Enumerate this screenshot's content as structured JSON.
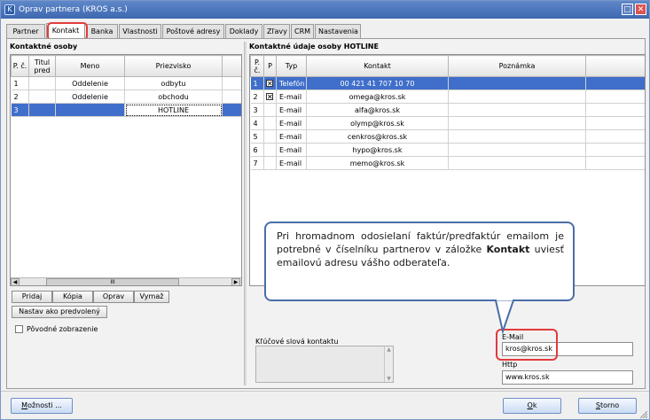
{
  "window": {
    "title": "Oprav partnera (KROS a.s.)",
    "icon": "app-icon",
    "buttons": {
      "restore": "□",
      "close": "✕"
    }
  },
  "tabs": [
    {
      "label": "Partner",
      "active": false
    },
    {
      "label": "Kontakt",
      "active": true
    },
    {
      "label": "Banka",
      "active": false
    },
    {
      "label": "Vlastnosti",
      "active": false
    },
    {
      "label": "Poštové adresy",
      "active": false
    },
    {
      "label": "Doklady",
      "active": false
    },
    {
      "label": "Zľavy",
      "active": false
    },
    {
      "label": "CRM",
      "active": false
    },
    {
      "label": "Nastavenia",
      "active": false
    }
  ],
  "left": {
    "title": "Kontaktné osoby",
    "columns": [
      "P. č.",
      "Titul pred",
      "Meno",
      "Priezvisko"
    ],
    "rows": [
      {
        "n": "1",
        "titul": "",
        "meno": "Oddelenie",
        "priezvisko": "odbytu",
        "selected": false
      },
      {
        "n": "2",
        "titul": "",
        "meno": "Oddelenie",
        "priezvisko": "obchodu",
        "selected": false
      },
      {
        "n": "3",
        "titul": "",
        "meno": "",
        "priezvisko": "HOTLINE",
        "selected": true
      }
    ],
    "scroll_thumb": "III",
    "buttons": {
      "add": "Pridaj",
      "copy": "Kópia",
      "edit": "Oprav",
      "delete": "Vymaž",
      "default": "Nastav ako predvolený"
    },
    "original_view_label": "Pôvodné zobrazenie"
  },
  "right": {
    "title": "Kontaktné údaje osoby HOTLINE",
    "columns": [
      "P. č.",
      "P",
      "Typ",
      "Kontakt",
      "Poznámka"
    ],
    "rows": [
      {
        "n": "1",
        "p": true,
        "typ": "Telefón",
        "kontakt": "00 421 41 707 10 70",
        "selected": true
      },
      {
        "n": "2",
        "p": true,
        "typ": "E-mail",
        "kontakt": "omega@kros.sk",
        "selected": false
      },
      {
        "n": "3",
        "p": false,
        "typ": "E-mail",
        "kontakt": "alfa@kros.sk",
        "selected": false
      },
      {
        "n": "4",
        "p": false,
        "typ": "E-mail",
        "kontakt": "olymp@kros.sk",
        "selected": false
      },
      {
        "n": "5",
        "p": false,
        "typ": "E-mail",
        "kontakt": "cenkros@kros.sk",
        "selected": false
      },
      {
        "n": "6",
        "p": false,
        "typ": "E-mail",
        "kontakt": "hypo@kros.sk",
        "selected": false
      },
      {
        "n": "7",
        "p": false,
        "typ": "E-mail",
        "kontakt": "memo@kros.sk",
        "selected": false
      }
    ],
    "keywords_label": "Kľúčové slová kontaktu"
  },
  "callout": {
    "text_before": "Pri hromadnom odosielaní faktúr/predfaktúr emailom je potrebné v číselníku partnerov v záložke ",
    "bold": "Kontakt",
    "text_after": " uviesť emailovú adresu vášho odberateľa."
  },
  "fields": {
    "email_label": "E-Mail",
    "email_value": "kros@kros.sk",
    "http_label": "Http",
    "http_value": "www.kros.sk"
  },
  "footer": {
    "options_prefix": "",
    "options_u": "M",
    "options_rest": "ožnosti ...",
    "ok_u": "O",
    "ok_rest": "k",
    "cancel_u": "S",
    "cancel_rest": "torno"
  }
}
